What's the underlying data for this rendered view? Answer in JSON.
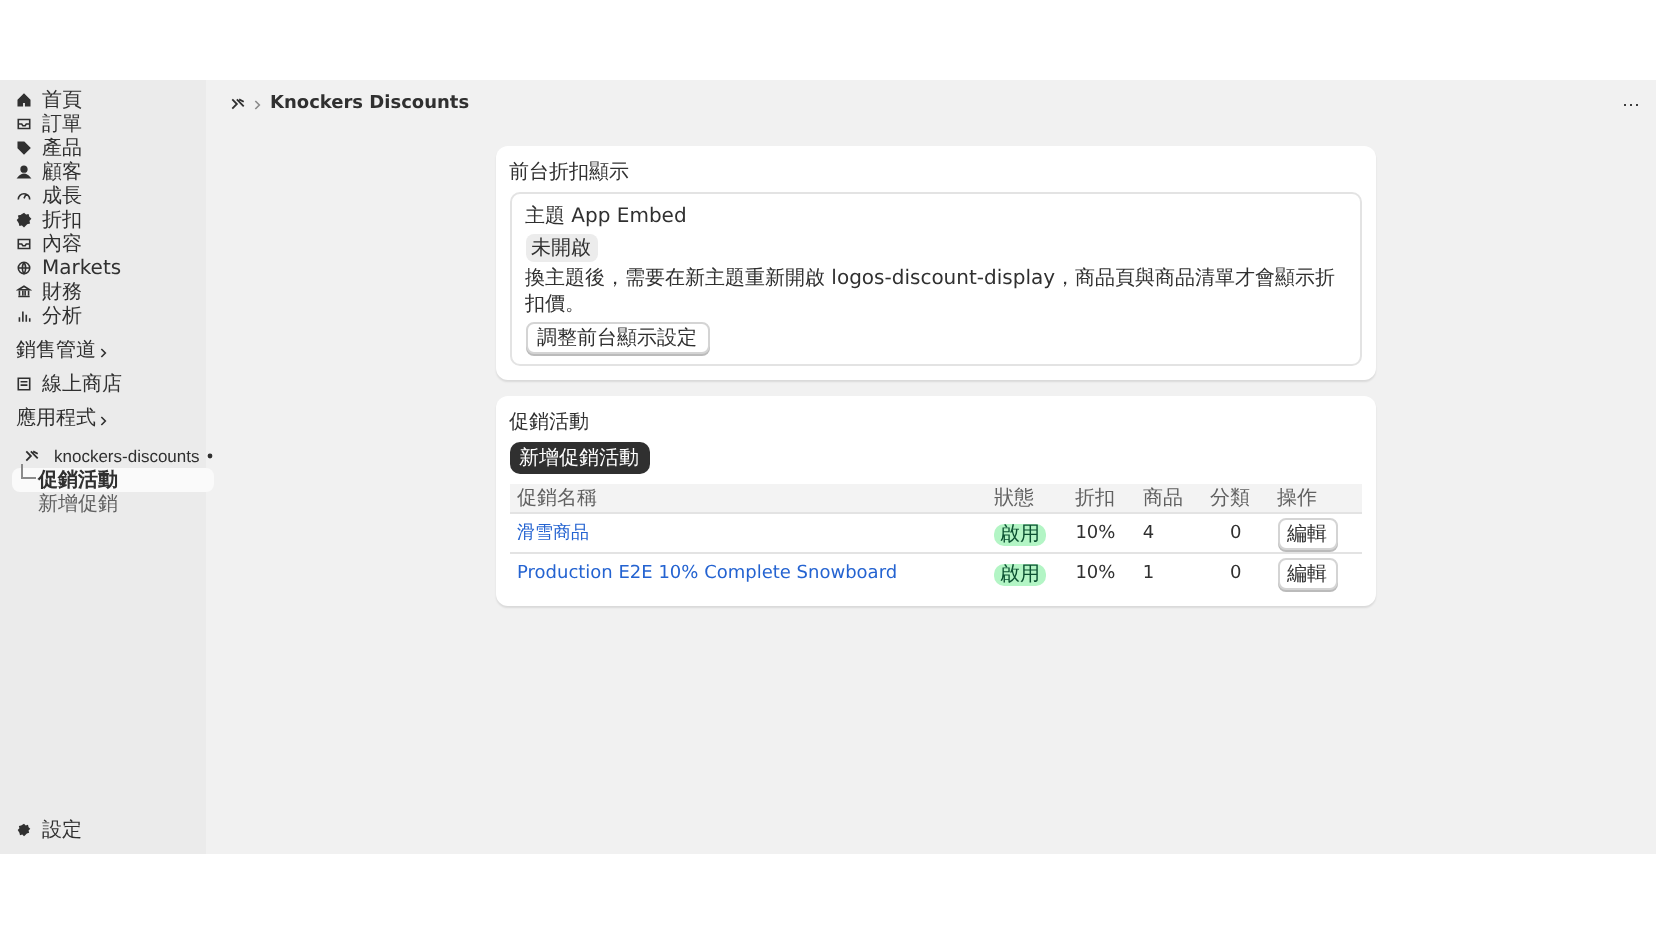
{
  "sidebar": {
    "items": [
      {
        "label": "首頁",
        "kind": "home",
        "selected": false
      },
      {
        "label": "訂單",
        "kind": "inbox",
        "selected": false
      },
      {
        "label": "產品",
        "kind": "tag",
        "selected": false
      },
      {
        "label": "顧客",
        "kind": "person",
        "selected": false
      },
      {
        "label": "成長",
        "kind": "gauge",
        "selected": false
      },
      {
        "label": "折扣",
        "kind": "gear",
        "selected": false
      },
      {
        "label": "內容",
        "kind": "inbox",
        "selected": false
      },
      {
        "label": "Markets",
        "kind": "globe",
        "selected": false
      },
      {
        "label": "財務",
        "kind": "bank",
        "selected": false
      },
      {
        "label": "分析",
        "kind": "bars",
        "selected": false
      }
    ],
    "sales_channels": {
      "heading": "銷售管道",
      "items": [
        {
          "label": "線上商店",
          "selected": false
        }
      ]
    },
    "apps": {
      "heading": "應用程式",
      "app": {
        "label": "knockers-discounts",
        "children": [
          {
            "label": "促銷活動",
            "selected": true
          },
          {
            "label": "新增促銷",
            "selected": false
          }
        ]
      }
    },
    "settings": "設定"
  },
  "header": {
    "title": "Knockers Discounts",
    "more": "⋯"
  },
  "display_card": {
    "title": "前台折扣顯示",
    "embed_title": "主題 App Embed",
    "badge": "未開啟",
    "description": "換主題後，需要在新主題重新開啟 logos-discount-display，商品頁與商品清單才會顯示折扣價。",
    "button": "調整前台顯示設定"
  },
  "promotions": {
    "title": "促銷活動",
    "new_button": "新增促銷活動",
    "table": {
      "columns": [
        "促銷名稱",
        "狀態",
        "折扣",
        "商品",
        "分類",
        "操作"
      ],
      "rows": [
        {
          "name": "滑雪商品",
          "status": "啟用",
          "active": true,
          "discount": "10%",
          "products": "4",
          "categories": "0",
          "action": "編輯"
        },
        {
          "name": "Production E2E 10% Complete Snowboard",
          "status": "啟用",
          "active": true,
          "discount": "10%",
          "products": "1",
          "categories": "0",
          "action": "編輯"
        }
      ]
    }
  }
}
